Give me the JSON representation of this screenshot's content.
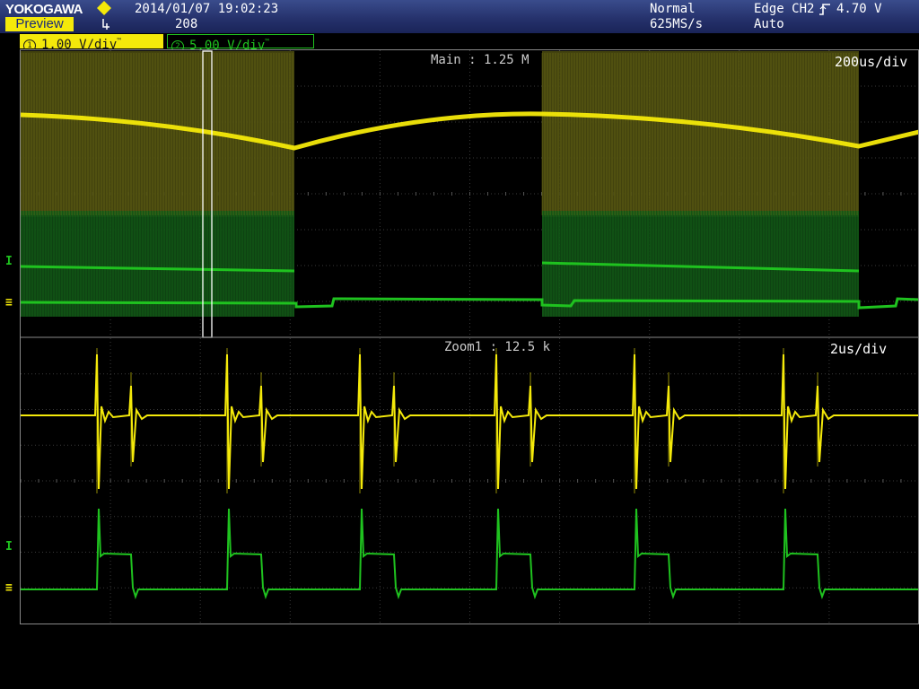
{
  "header": {
    "logo": "YOKOGAWA",
    "mode_button": "Preview",
    "datetime": "2014/01/07 19:02:23",
    "acq_count": "208",
    "acq_mode": "Normal",
    "sample_rate": "625MS/s",
    "trigger_type": "Edge CH2",
    "trigger_level": "4.70 V",
    "trigger_mode": "Auto"
  },
  "channels": [
    {
      "id": "1",
      "scale": "1.00 V/div",
      "color": "#f4e90a"
    },
    {
      "id": "2",
      "scale": "5.00 V/div",
      "color": "#1fc21f"
    }
  ],
  "main_panel": {
    "label": "Main : 1.25 M",
    "timebase": "200us/div"
  },
  "zoom_panel": {
    "label": "Zoom1 : 12.5 k",
    "timebase": "2us/div"
  },
  "markers": {
    "level": "I",
    "ground": "≡"
  },
  "colors": {
    "ch1": "#f4e90a",
    "ch2": "#1fc21f",
    "grid": "#3a3a3a",
    "header": "#24306a"
  }
}
